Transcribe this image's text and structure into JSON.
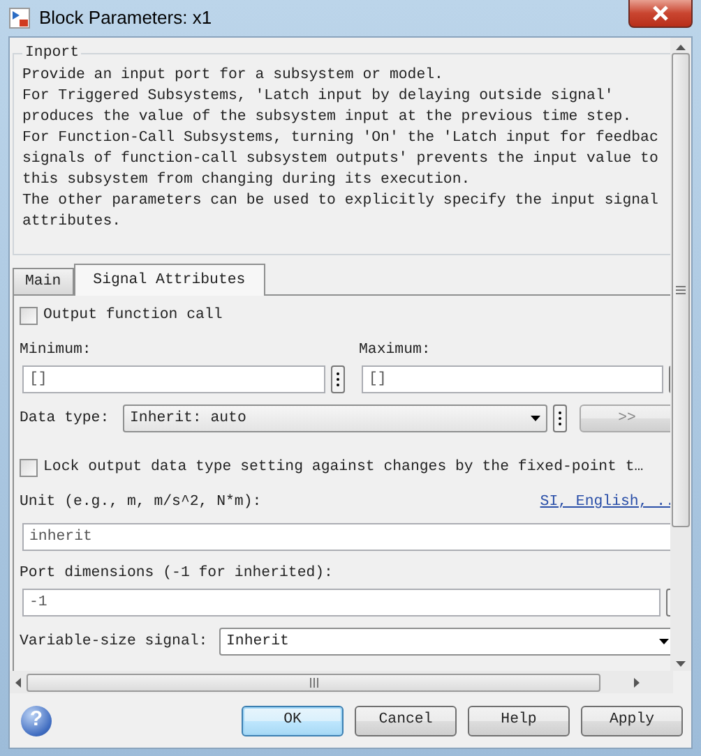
{
  "window": {
    "title": "Block Parameters: x1"
  },
  "group": {
    "title": "Inport",
    "lines": [
      "Provide an input port for a subsystem or model.",
      "For Triggered Subsystems, 'Latch input by delaying outside signal'",
      "produces the value of the subsystem input at the previous time step.",
      "For Function-Call Subsystems, turning 'On' the 'Latch input for feedbac",
      "signals of function-call subsystem outputs' prevents the input value to",
      "this subsystem from changing during its execution.",
      "The other parameters can be used to explicitly specify the input signal",
      "attributes."
    ]
  },
  "tabs": [
    {
      "label": "Main",
      "selected": false
    },
    {
      "label": "Signal Attributes",
      "selected": true
    }
  ],
  "output_function_call": {
    "label": "Output function call",
    "checked": false
  },
  "minimum": {
    "label": "Minimum:",
    "value": "[]"
  },
  "maximum": {
    "label": "Maximum:",
    "value": "[]"
  },
  "data_type": {
    "label": "Data type:",
    "value": "Inherit: auto",
    "assistant_button": ">>"
  },
  "lock_output": {
    "label": "Lock output data type setting against changes by the fixed-point t…",
    "checked": false
  },
  "unit": {
    "label": "Unit (e.g., m, m/s^2, N*m):",
    "link": "SI, English, ..",
    "value": "inherit"
  },
  "port_dimensions": {
    "label": "Port dimensions (-1 for inherited):",
    "value": "-1"
  },
  "variable_size": {
    "label": "Variable-size signal:",
    "value": "Inherit"
  },
  "help_icon": "?",
  "buttons": [
    {
      "label": "OK",
      "default": true
    },
    {
      "label": "Cancel",
      "default": false
    },
    {
      "label": "Help",
      "default": false
    },
    {
      "label": "Apply",
      "default": false
    }
  ]
}
